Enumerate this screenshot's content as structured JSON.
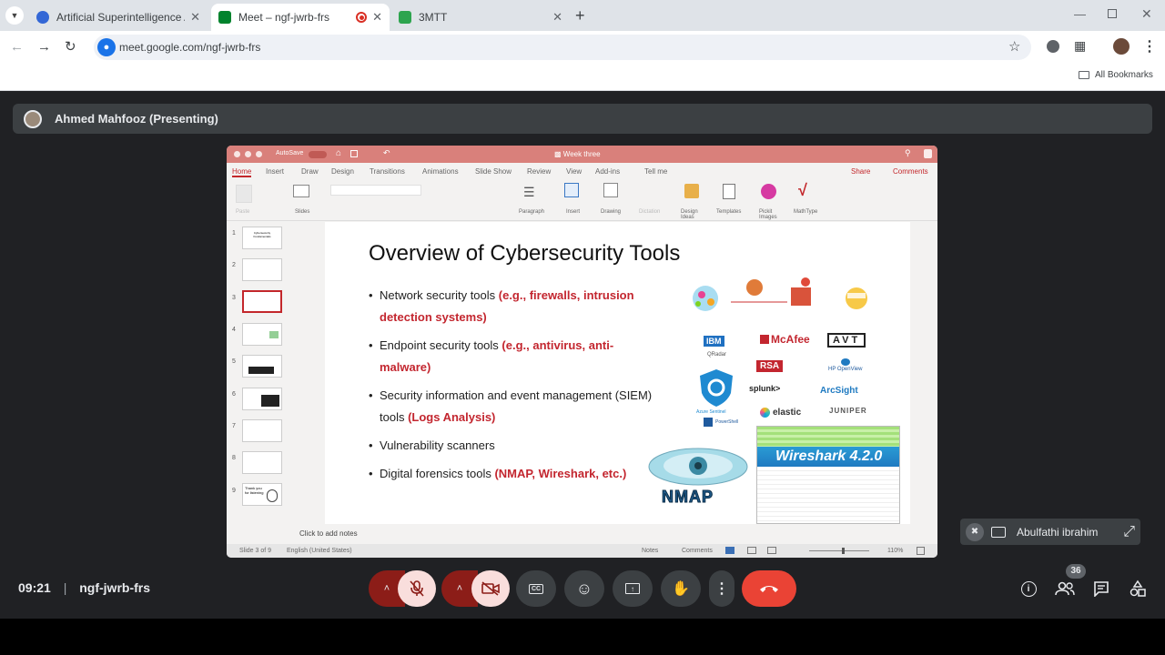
{
  "browser": {
    "tabs": [
      {
        "title": "Artificial Superintelligence Allia",
        "favicon_color": "#3367d6"
      },
      {
        "title": "Meet – ngf-jwrb-frs",
        "favicon_color": "#00832d",
        "recording_dot": "#d93025"
      },
      {
        "title": "3MTT",
        "favicon_color": "#2da44e"
      }
    ],
    "url": "meet.google.com/ngf-jwrb-frs",
    "bookmarks_label": "All Bookmarks"
  },
  "meet": {
    "presenter_label": "Ahmed Mahfooz (Presenting)",
    "participant_name": "Abulfathi ibrahim",
    "time": "09:21",
    "meeting_code": "ngf-jwrb-frs",
    "participant_count": "36",
    "end_call_color": "#ea4335",
    "muted_color": "#f9dedc"
  },
  "ppt": {
    "autosave": "AutoSave",
    "doc_title": "Week three",
    "ribbon_tabs": [
      "Home",
      "Insert",
      "Draw",
      "Design",
      "Transitions",
      "Animations",
      "Slide Show",
      "Review",
      "View",
      "Add-ins",
      "Tell me"
    ],
    "share": "Share",
    "comments": "Comments",
    "ribbon_groups": [
      "Paste",
      "Slides",
      "Paragraph",
      "Insert",
      "Drawing",
      "Dictation",
      "Design Ideas",
      "Templates",
      "Pickit Images",
      "MathType"
    ],
    "slide_numbers": [
      "1",
      "2",
      "3",
      "4",
      "5",
      "6",
      "7",
      "8",
      "9"
    ],
    "notes_placeholder": "Click to add notes",
    "status_slide": "Slide 3 of 9",
    "status_lang": "English (United States)",
    "status_notes": "Notes",
    "status_comments": "Comments",
    "zoom": "110%",
    "thumb1_text": "Cybersecurity Fundamentals",
    "thumb9_text": "Thank you for listening"
  },
  "slide": {
    "title": "Overview of Cybersecurity Tools",
    "bullets": [
      {
        "text": "Network security tools ",
        "highlight": "(e.g., firewalls, intrusion detection systems)"
      },
      {
        "text": "Endpoint security tools ",
        "highlight": "(e.g., antivirus, anti-malware)"
      },
      {
        "text": "Security information and event management (SIEM) tools ",
        "highlight": "(Logs Analysis)"
      },
      {
        "text": "Vulnerability scanners",
        "highlight": ""
      },
      {
        "text": "Digital forensics tools ",
        "highlight": "(NMAP, Wireshark, etc.)"
      }
    ],
    "logos": {
      "ibm": "IBM",
      "qradar": "QRadar",
      "mcafee": "McAfee",
      "avt": "AVT",
      "rsa": "RSA",
      "hp": "HP OpenView",
      "splunk": "splunk>",
      "arcsight": "ArcSight",
      "elastic": "elastic",
      "juniper": "JUNIPER",
      "azure": "Azure Sentinel",
      "powershell": "PowerShell",
      "wireshark": "Wireshark 4.2.0",
      "nmap": "NMAP"
    }
  }
}
